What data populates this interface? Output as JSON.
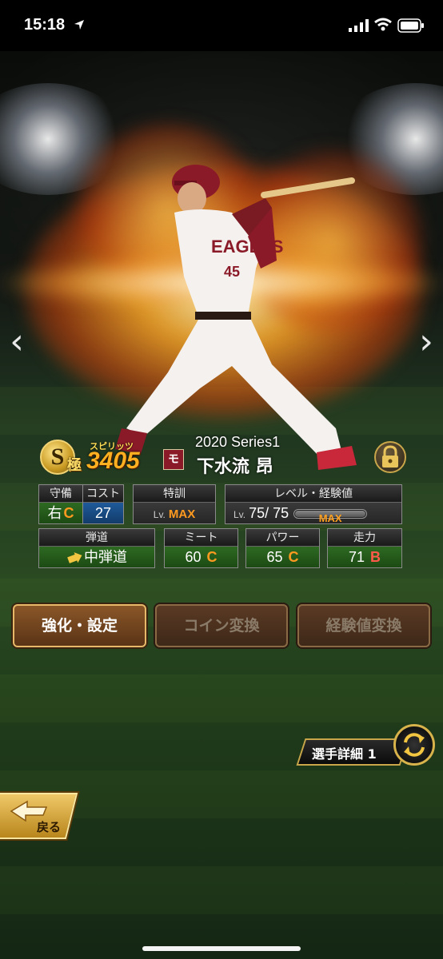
{
  "status_bar": {
    "time": "15:18"
  },
  "card": {
    "rank": "S",
    "grade": "極",
    "spirits_label": "スピリッツ",
    "spirits_value": "3405",
    "team_icon": "モ",
    "series": "2020 Series1",
    "player_name": "下水流 昂"
  },
  "stats": {
    "position": {
      "label": "守備",
      "value": "右",
      "grade": "C"
    },
    "cost": {
      "label": "コスト",
      "value": "27"
    },
    "special_training": {
      "label": "特訓",
      "lv": "Lv.",
      "value": "MAX"
    },
    "level_exp": {
      "label": "レベル・経験値",
      "lv": "Lv.",
      "value": "75/ 75",
      "bar_label": "MAX",
      "bar_fraction": 1.0
    },
    "trajectory": {
      "label": "弾道",
      "value": "中弾道"
    },
    "meet": {
      "label": "ミート",
      "value": "60",
      "grade": "C"
    },
    "power": {
      "label": "パワー",
      "value": "65",
      "grade": "C"
    },
    "speed": {
      "label": "走力",
      "value": "71",
      "grade": "B"
    }
  },
  "buttons": {
    "enhance": "強化・設定",
    "coin_exchange": "コイン変換",
    "exp_exchange": "経験値変換"
  },
  "detail": {
    "label": "選手詳細 1"
  },
  "back": {
    "label": "戻る"
  },
  "nav": {
    "prev": "‹",
    "next": "›"
  },
  "colors": {
    "gold": "#c9a64a",
    "grade_c": "#ff9a20",
    "grade_b": "#ff5a4a",
    "green": "#2e6a22",
    "blue": "#1f5a9a"
  },
  "icons": [
    "location-icon",
    "signal-icon",
    "wifi-icon",
    "battery-icon",
    "lock-icon",
    "switch-icon",
    "back-arrow-icon",
    "team-icon"
  ]
}
